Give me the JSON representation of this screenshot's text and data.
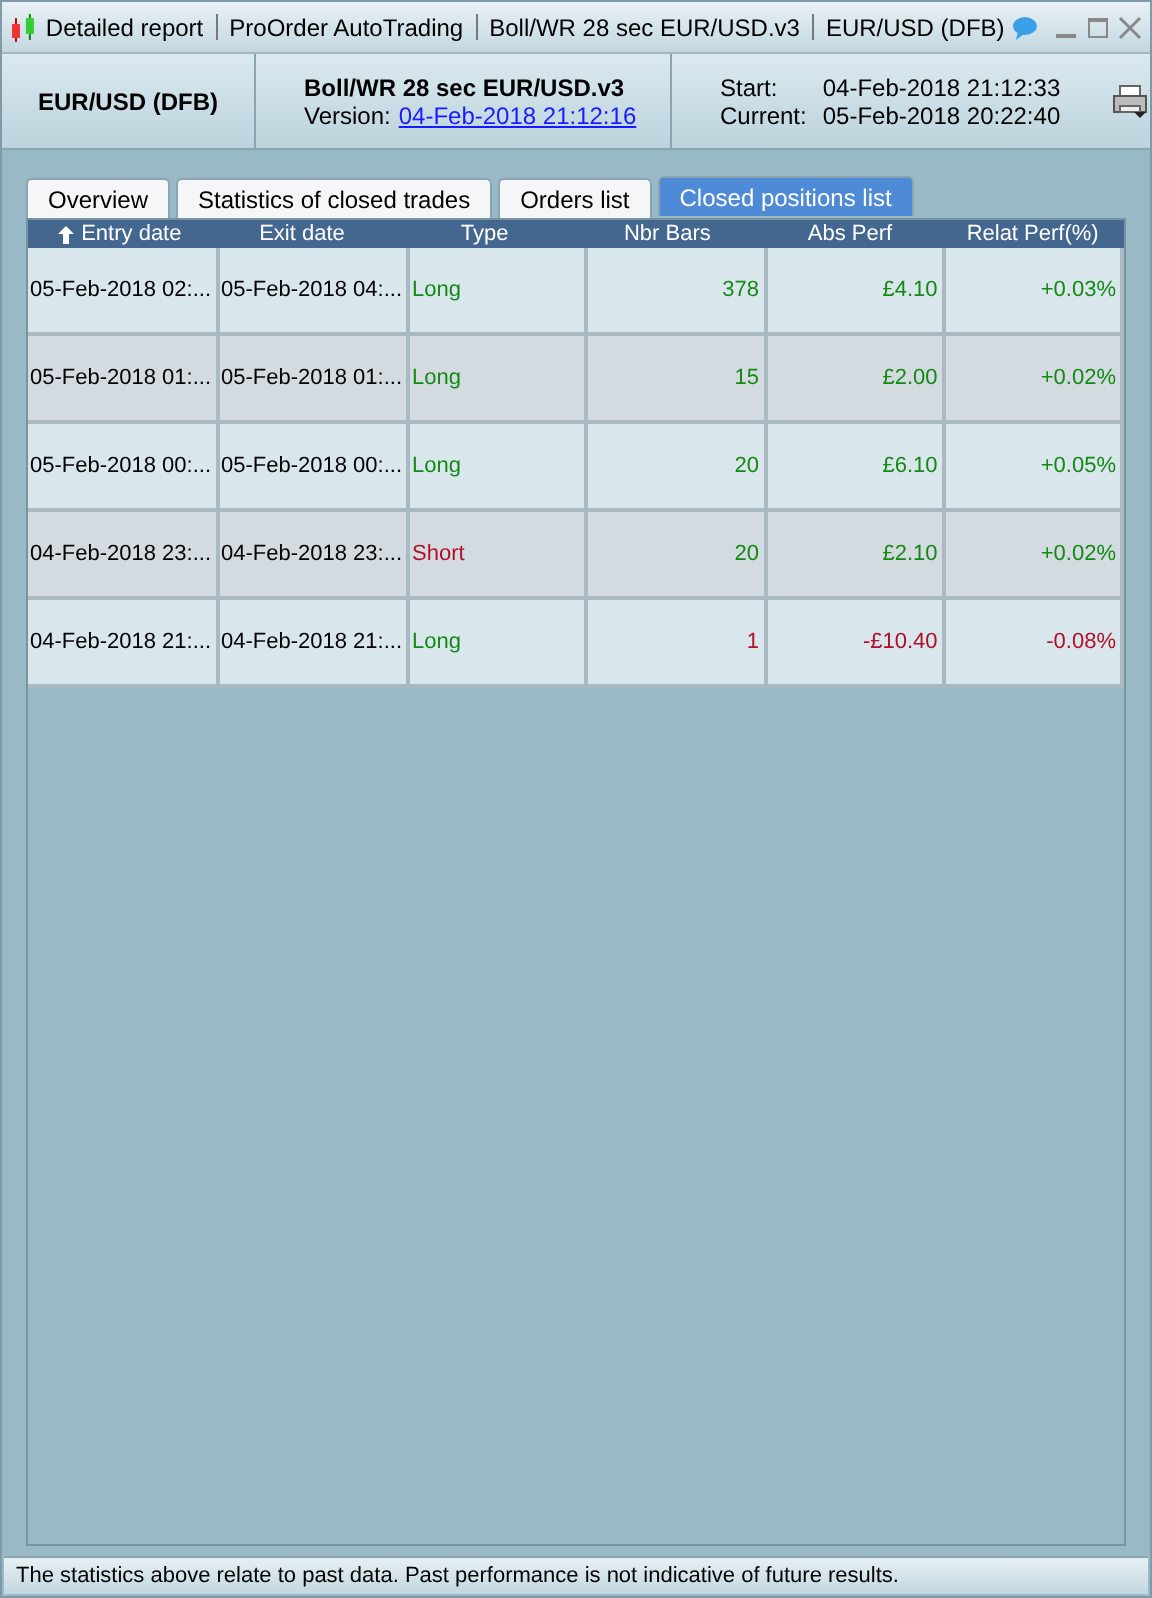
{
  "window": {
    "title_parts": [
      "Detailed report",
      "ProOrder AutoTrading",
      "Boll/WR 28 sec EUR/USD.v3",
      "EUR/USD (DFB)"
    ]
  },
  "header": {
    "instrument": "EUR/USD (DFB)",
    "system": "Boll/WR 28 sec EUR/USD.v3",
    "version_label": "Version:",
    "version_link": "04-Feb-2018 21:12:16",
    "start_label": "Start:",
    "start_value": "04-Feb-2018 21:12:33",
    "current_label": "Current:",
    "current_value": "05-Feb-2018 20:22:40"
  },
  "tabs": [
    {
      "label": "Overview",
      "selected": false
    },
    {
      "label": "Statistics of closed trades",
      "selected": false
    },
    {
      "label": "Orders list",
      "selected": false
    },
    {
      "label": "Closed positions list",
      "selected": true
    }
  ],
  "table": {
    "columns": [
      {
        "label": "Entry date",
        "sorted": true
      },
      {
        "label": "Exit date",
        "sorted": false
      },
      {
        "label": "Type",
        "sorted": false
      },
      {
        "label": "Nbr Bars",
        "sorted": false
      },
      {
        "label": "Abs Perf",
        "sorted": false
      },
      {
        "label": "Relat Perf(%)",
        "sorted": false
      }
    ],
    "rows": [
      {
        "cells": [
          {
            "text": "05-Feb-2018 02:...",
            "color": "#000000"
          },
          {
            "text": "05-Feb-2018 04:...",
            "color": "#000000"
          },
          {
            "text": "Long",
            "color": "#138a13"
          },
          {
            "text": "378",
            "color": "#138a13"
          },
          {
            "text": "£4.10",
            "color": "#138a13"
          },
          {
            "text": "+0.03%",
            "color": "#138a13"
          }
        ]
      },
      {
        "cells": [
          {
            "text": "05-Feb-2018 01:...",
            "color": "#000000"
          },
          {
            "text": "05-Feb-2018 01:...",
            "color": "#000000"
          },
          {
            "text": "Long",
            "color": "#138a13"
          },
          {
            "text": "15",
            "color": "#138a13"
          },
          {
            "text": "£2.00",
            "color": "#138a13"
          },
          {
            "text": "+0.02%",
            "color": "#138a13"
          }
        ]
      },
      {
        "cells": [
          {
            "text": "05-Feb-2018 00:...",
            "color": "#000000"
          },
          {
            "text": "05-Feb-2018 00:...",
            "color": "#000000"
          },
          {
            "text": "Long",
            "color": "#138a13"
          },
          {
            "text": "20",
            "color": "#138a13"
          },
          {
            "text": "£6.10",
            "color": "#138a13"
          },
          {
            "text": "+0.05%",
            "color": "#138a13"
          }
        ]
      },
      {
        "cells": [
          {
            "text": "04-Feb-2018 23:...",
            "color": "#000000"
          },
          {
            "text": "04-Feb-2018 23:...",
            "color": "#000000"
          },
          {
            "text": "Short",
            "color": "#b0102a"
          },
          {
            "text": "20",
            "color": "#138a13"
          },
          {
            "text": "£2.10",
            "color": "#138a13"
          },
          {
            "text": "+0.02%",
            "color": "#138a13"
          }
        ]
      },
      {
        "cells": [
          {
            "text": "04-Feb-2018 21:...",
            "color": "#000000"
          },
          {
            "text": "04-Feb-2018 21:...",
            "color": "#000000"
          },
          {
            "text": "Long",
            "color": "#138a13"
          },
          {
            "text": "1",
            "color": "#b0102a"
          },
          {
            "text": "-£10.40",
            "color": "#b0102a"
          },
          {
            "text": "-0.08%",
            "color": "#b0102a"
          }
        ]
      }
    ]
  },
  "status_bar": "The statistics above relate to past data. Past performance is not indicative of future results."
}
